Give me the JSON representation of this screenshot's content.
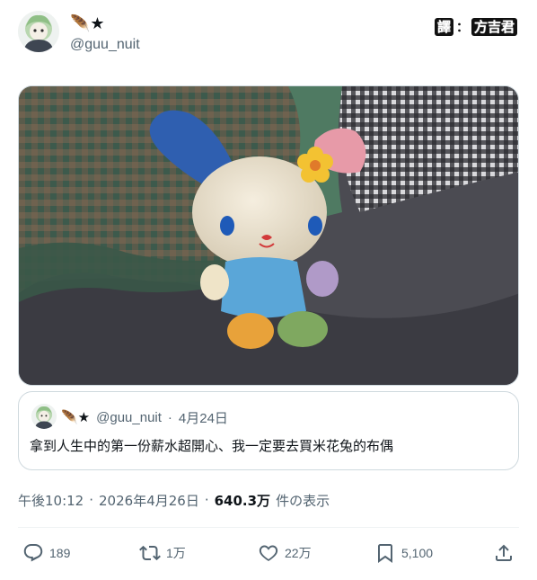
{
  "author": {
    "display_name": "🪶★",
    "handle": "@guu_nuit"
  },
  "watermark": {
    "left": "譯",
    "sep": "：",
    "right": "方吉君"
  },
  "quoted_post": {
    "display_name": "🪶★",
    "handle": "@guu_nuit",
    "separator": "·",
    "date": "4月24日",
    "text": "拿到人生中的第一份薪水超開心、我一定要去買米花兔的布偶"
  },
  "meta": {
    "time": "午後10:12",
    "separator": "·",
    "date": "2026年4月26日",
    "views_count": "640.3万",
    "views_label": "件の表示"
  },
  "actions": {
    "reply_count": "189",
    "repost_count": "1万",
    "like_count": "22万",
    "bookmark_count": "5,100"
  },
  "icons": {
    "reply": "reply-icon",
    "repost": "repost-icon",
    "like": "heart-icon",
    "bookmark": "bookmark-icon",
    "share": "share-icon"
  },
  "colors": {
    "text_secondary": "#536471",
    "text_primary": "#0f1419",
    "border": "#cfd9de"
  }
}
